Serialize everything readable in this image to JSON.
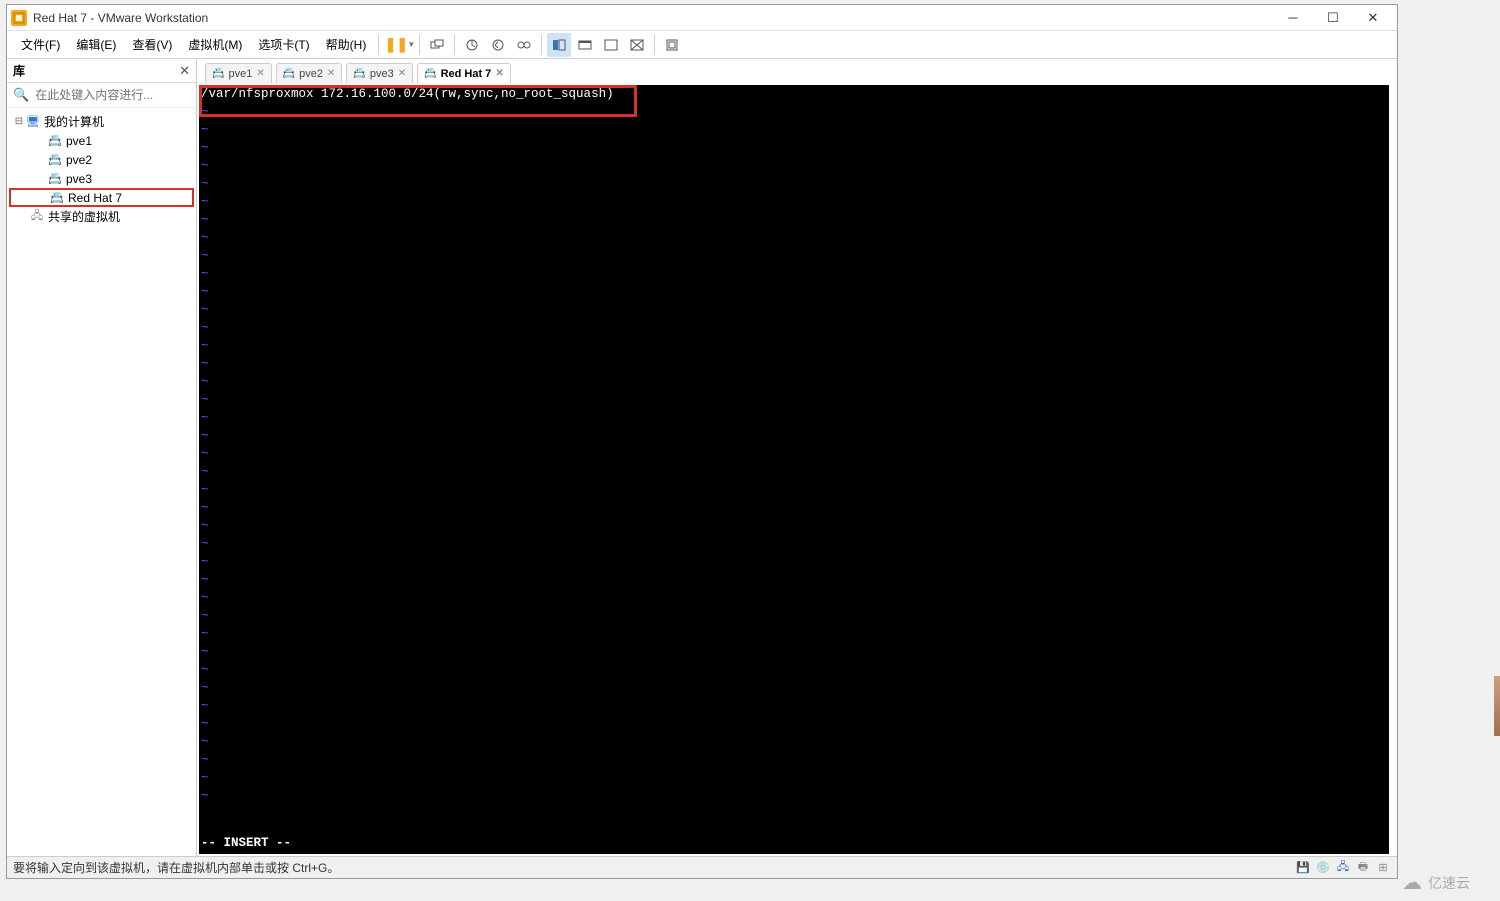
{
  "titlebar": {
    "title": "Red Hat 7 - VMware Workstation"
  },
  "menubar": {
    "file": "文件(F)",
    "edit": "编辑(E)",
    "view": "查看(V)",
    "vm": "虚拟机(M)",
    "tabs": "选项卡(T)",
    "help": "帮助(H)"
  },
  "sidebar": {
    "header": "库",
    "search_placeholder": "在此处键入内容进行...",
    "root": "我的计算机",
    "items": [
      "pve1",
      "pve2",
      "pve3",
      "Red Hat 7"
    ],
    "shared": "共享的虚拟机"
  },
  "tabs": [
    {
      "label": "pve1",
      "active": false
    },
    {
      "label": "pve2",
      "active": false
    },
    {
      "label": "pve3",
      "active": false
    },
    {
      "label": "Red Hat 7",
      "active": true
    }
  ],
  "terminal": {
    "line1": "/var/nfsproxmox 172.16.100.0/24(rw,sync,no_root_squash)",
    "mode": "-- INSERT --"
  },
  "statusbar": {
    "text": "要将输入定向到该虚拟机，请在虚拟机内部单击或按 Ctrl+G。"
  },
  "watermark": {
    "text": "亿速云"
  }
}
